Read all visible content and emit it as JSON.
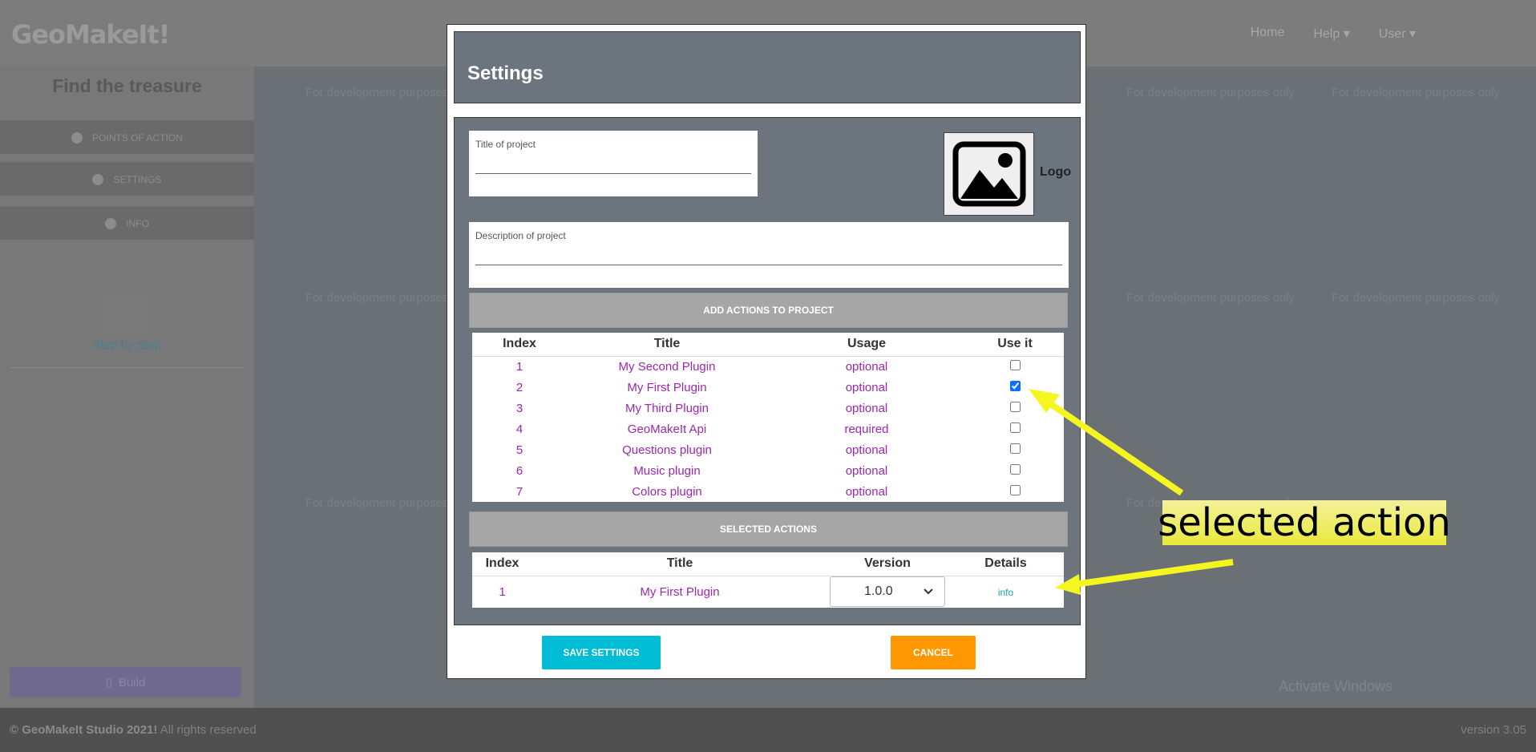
{
  "app": {
    "brand": "GeoMakeIt!",
    "nav": [
      "Home",
      "Help",
      "User"
    ]
  },
  "sidebar": {
    "project_title": "Find the treasure",
    "items": [
      {
        "label": "POINTS OF ACTION",
        "icon": "map-pin-icon"
      },
      {
        "label": "SETTINGS",
        "icon": "gear-icon"
      },
      {
        "label": "INFO",
        "icon": "info-icon"
      }
    ],
    "step_link": "Step by Step",
    "build_label": "Build"
  },
  "map": {
    "watermark": "For development purposes only",
    "activate": "Activate Windows"
  },
  "footer": {
    "copyright_bold": "© GeoMakeIt Studio 2021!",
    "copyright_rest": " All rights reserved",
    "version": "version 3.05"
  },
  "modal": {
    "title": "Settings",
    "title_field_label": "Title of project",
    "title_field_value": "",
    "description_field_label": "Description of project",
    "description_field_value": "",
    "logo_label": "Logo",
    "add_actions_label": "ADD ACTIONS TO PROJECT",
    "actions_table": {
      "headers": [
        "Index",
        "Title",
        "Usage",
        "Use it"
      ],
      "rows": [
        {
          "index": "1",
          "title": "My Second Plugin",
          "usage": "optional",
          "checked": false
        },
        {
          "index": "2",
          "title": "My First Plugin",
          "usage": "optional",
          "checked": true
        },
        {
          "index": "3",
          "title": "My Third Plugin",
          "usage": "optional",
          "checked": false
        },
        {
          "index": "4",
          "title": "GeoMakeIt Api",
          "usage": "required",
          "checked": false
        },
        {
          "index": "5",
          "title": "Questions plugin",
          "usage": "optional",
          "checked": false
        },
        {
          "index": "6",
          "title": "Music plugin",
          "usage": "optional",
          "checked": false
        },
        {
          "index": "7",
          "title": "Colors plugin",
          "usage": "optional",
          "checked": false
        }
      ]
    },
    "selected_actions_label": "SELECTED ACTIONS",
    "selected_table": {
      "headers": [
        "Index",
        "Title",
        "Version",
        "Details"
      ],
      "rows": [
        {
          "index": "1",
          "title": "My First Plugin",
          "version": "1.0.0",
          "details": "info"
        }
      ]
    },
    "save_label": "SAVE SETTINGS",
    "cancel_label": "CANCEL"
  },
  "annotation": {
    "text": "selected action"
  },
  "colors": {
    "accent_purple": "#9c27b0",
    "save": "#00bcd4",
    "cancel": "#ff9800",
    "annotation": "#e9e93a"
  }
}
